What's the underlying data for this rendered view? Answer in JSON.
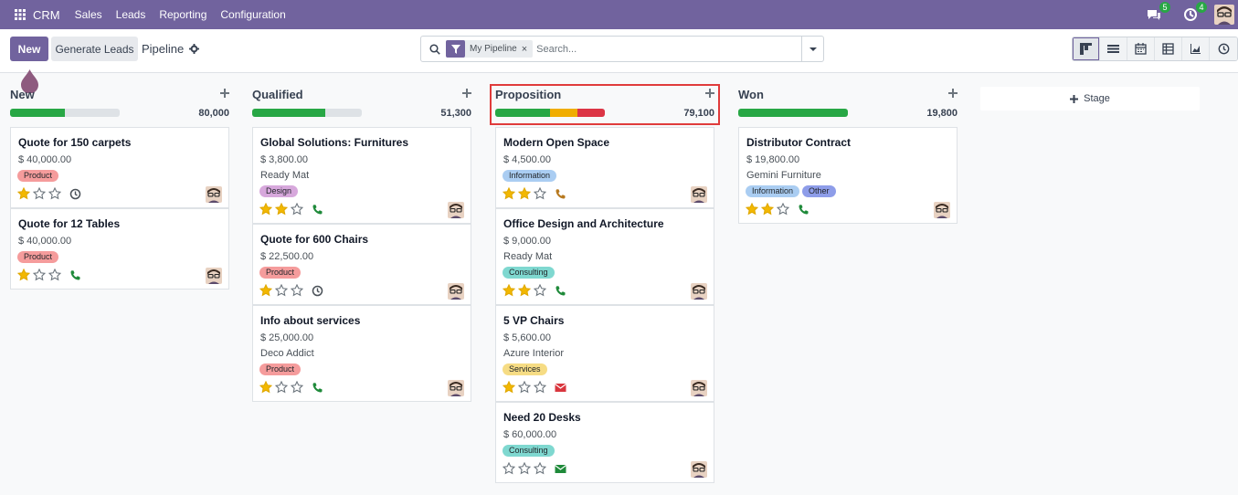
{
  "navbar": {
    "brand": "CRM",
    "menu": [
      "Sales",
      "Leads",
      "Reporting",
      "Configuration"
    ],
    "messages_count": "5",
    "activities_count": "4",
    "bg_color": "#71639e"
  },
  "control": {
    "new_label": "New",
    "generate_label": "Generate Leads",
    "breadcrumb": "Pipeline",
    "facet_label": "My Pipeline",
    "facet_remove": "×",
    "search_placeholder": "Search...",
    "views": [
      "kanban-icon",
      "list-icon",
      "calendar-icon",
      "pivot-icon",
      "graph-icon",
      "activity-icon"
    ]
  },
  "columns": [
    {
      "title": "New",
      "total": "80,000",
      "progress": {
        "green": 0.5,
        "orange": 0,
        "red": 0
      },
      "cards": [
        {
          "title": "Quote for 150 carpets",
          "amount": "$ 40,000.00",
          "company": "",
          "tags": [
            {
              "label": "Product",
              "kind": "product"
            }
          ],
          "stars": 1,
          "activity": "clock"
        },
        {
          "title": "Quote for 12 Tables",
          "amount": "$ 40,000.00",
          "company": "",
          "tags": [
            {
              "label": "Product",
              "kind": "product"
            }
          ],
          "stars": 1,
          "activity": "phone"
        }
      ]
    },
    {
      "title": "Qualified",
      "total": "51,300",
      "progress": {
        "green": 0.67,
        "orange": 0,
        "red": 0
      },
      "cards": [
        {
          "title": "Global Solutions: Furnitures",
          "amount": "$ 3,800.00",
          "company": "Ready Mat",
          "tags": [
            {
              "label": "Design",
              "kind": "design"
            }
          ],
          "stars": 2,
          "activity": "phone"
        },
        {
          "title": "Quote for 600 Chairs",
          "amount": "$ 22,500.00",
          "company": "",
          "tags": [
            {
              "label": "Product",
              "kind": "product"
            }
          ],
          "stars": 1,
          "activity": "clock"
        },
        {
          "title": "Info about services",
          "amount": "$ 25,000.00",
          "company": "Deco Addict",
          "tags": [
            {
              "label": "Product",
              "kind": "product"
            }
          ],
          "stars": 1,
          "activity": "phone"
        }
      ]
    },
    {
      "title": "Proposition",
      "total": "79,100",
      "progress": {
        "green": 0.5,
        "orange": 0.25,
        "red": 0.25
      },
      "cards": [
        {
          "title": "Modern Open Space",
          "amount": "$ 4,500.00",
          "company": "",
          "tags": [
            {
              "label": "Information",
              "kind": "information"
            }
          ],
          "stars": 2,
          "activity": "phone-orange"
        },
        {
          "title": "Office Design and Architecture",
          "amount": "$ 9,000.00",
          "company": "Ready Mat",
          "tags": [
            {
              "label": "Consulting",
              "kind": "consulting"
            }
          ],
          "stars": 2,
          "activity": "phone"
        },
        {
          "title": "5 VP Chairs",
          "amount": "$ 5,600.00",
          "company": "Azure Interior",
          "tags": [
            {
              "label": "Services",
              "kind": "services"
            }
          ],
          "stars": 1,
          "activity": "mail-red"
        },
        {
          "title": "Need 20 Desks",
          "amount": "$ 60,000.00",
          "company": "",
          "tags": [
            {
              "label": "Consulting",
              "kind": "consulting"
            }
          ],
          "stars": 0,
          "activity": "mail-green"
        }
      ]
    },
    {
      "title": "Won",
      "total": "19,800",
      "progress": {
        "green": 1.0,
        "orange": 0,
        "red": 0
      },
      "cards": [
        {
          "title": "Distributor Contract",
          "amount": "$ 19,800.00",
          "company": "Gemini Furniture",
          "tags": [
            {
              "label": "Information",
              "kind": "information"
            },
            {
              "label": "Other",
              "kind": "other"
            }
          ],
          "stars": 2,
          "activity": "phone"
        }
      ]
    }
  ],
  "add_stage_label": "Stage"
}
